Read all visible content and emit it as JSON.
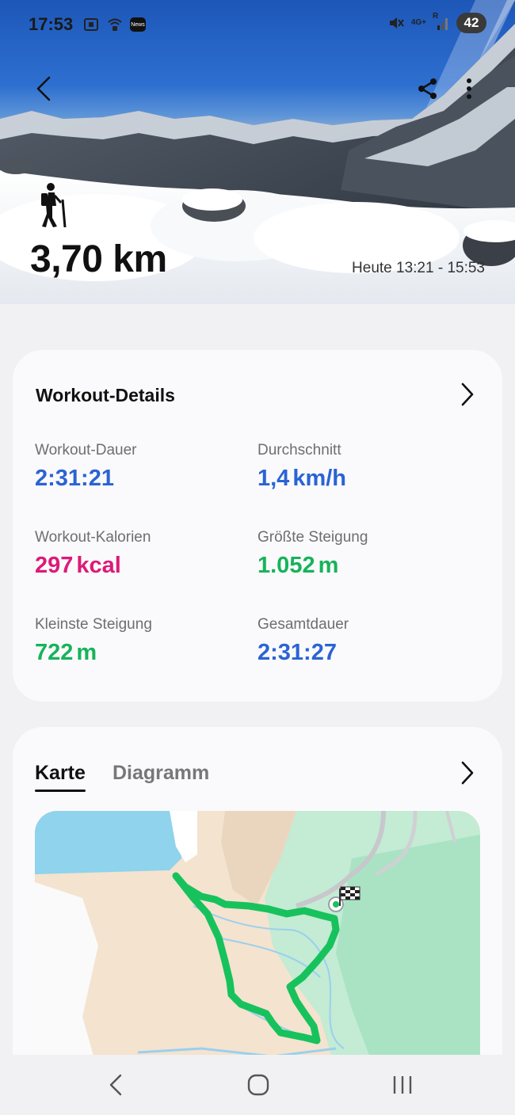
{
  "status_bar": {
    "time": "17:53",
    "news_badge": "News",
    "network_label": "4G+",
    "roaming_label": "R",
    "battery": "42"
  },
  "hero": {
    "activity_icon": "hiker-icon",
    "distance": "3,70 km",
    "time_range": "Heute 13:21 - 15:53"
  },
  "workout_details": {
    "title": "Workout-Details",
    "stats": [
      {
        "label": "Workout-Dauer",
        "value": "2:31:21",
        "unit": "",
        "color": "#2a63d4"
      },
      {
        "label": "Durchschnitt",
        "value": "1,4",
        "unit": "km/h",
        "color": "#2a63d4"
      },
      {
        "label": "Workout-Kalorien",
        "value": "297",
        "unit": "kcal",
        "color": "#dd1a78"
      },
      {
        "label": "Größte Steigung",
        "value": "1.052",
        "unit": "m",
        "color": "#17b35a"
      },
      {
        "label": "Kleinste Steigung",
        "value": "722",
        "unit": "m",
        "color": "#17b35a"
      },
      {
        "label": "Gesamtdauer",
        "value": "2:31:27",
        "unit": "",
        "color": "#2a63d4"
      }
    ]
  },
  "map_card": {
    "tabs": [
      {
        "label": "Karte",
        "active": true
      },
      {
        "label": "Diagramm",
        "active": false
      }
    ],
    "route_color": "#17b35a"
  },
  "colors": {
    "accent_blue": "#2a63d4",
    "accent_pink": "#dd1a78",
    "accent_green": "#17b35a"
  }
}
